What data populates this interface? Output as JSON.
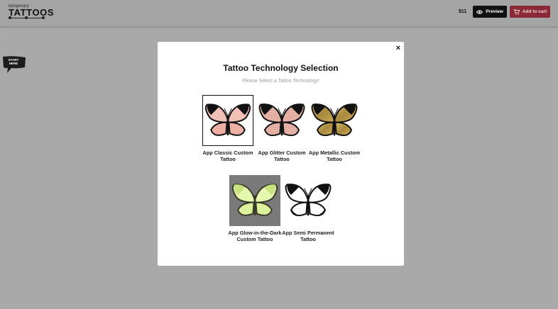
{
  "header": {
    "logo_small": "temporary",
    "logo_big": "TATTOOS",
    "price": "$11",
    "preview_label": "Preview",
    "cart_label": "Add to cart"
  },
  "badge": {
    "line1": "START",
    "line2": "HERE"
  },
  "modal": {
    "close": "×",
    "title": "Tattoo Technology Selection",
    "subtitle": "Please Select a Tattoo Technology!",
    "options": [
      {
        "line1": "App Classic Custom",
        "line2": "Tattoo",
        "selected": true
      },
      {
        "line1": "App Glitter Custom",
        "line2": "Tattoo",
        "selected": false
      },
      {
        "line1": "App Metallic Custom",
        "line2": "Tattoo",
        "selected": false
      },
      {
        "line1": "App Glow-in-the-Dark",
        "line2": "Custom Tattoo",
        "selected": false
      },
      {
        "line1": "App Semi Permanent",
        "line2": "Tattoo",
        "selected": false
      }
    ]
  },
  "colors": {
    "cart_button": "#8b2a36",
    "preview_button": "#111111",
    "overlay": "#a9a9a9"
  }
}
